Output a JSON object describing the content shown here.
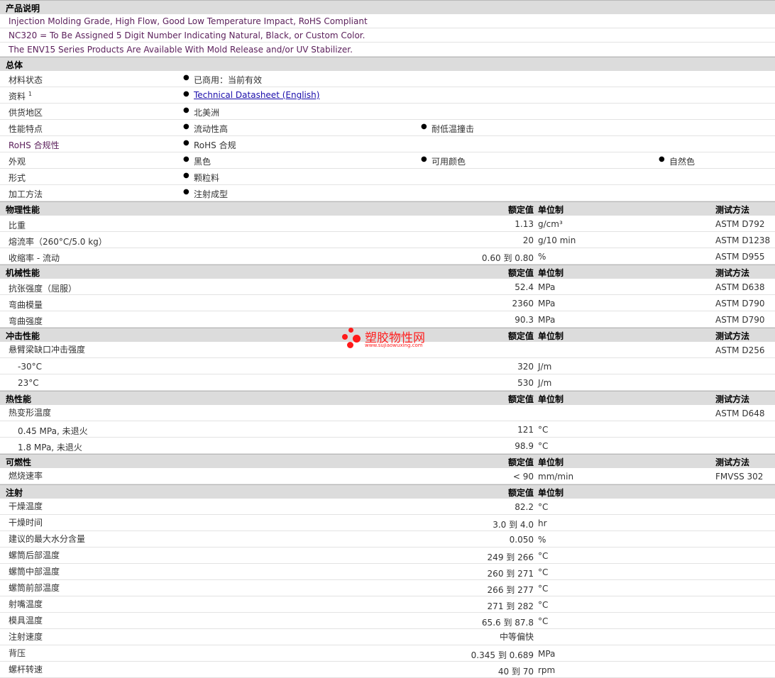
{
  "sections": {
    "product_desc": "产品说明",
    "general": "总体",
    "physical": "物理性能",
    "mechanical": "机械性能",
    "impact": "冲击性能",
    "thermal": "热性能",
    "flammability": "可燃性",
    "injection": "注射"
  },
  "headers": {
    "nominal": "额定值",
    "unit": "单位制",
    "method": "测试方法"
  },
  "bullet": "●",
  "description": [
    "Injection Molding Grade, High Flow, Good Low Temperature Impact, RoHS Compliant",
    "NC320 = To Be Assigned 5 Digit Number Indicating Natural, Black, or Custom Color.",
    "The ENV15 Series Products Are Available With Mold Release and/or UV Stabilizer."
  ],
  "general": {
    "material_status": {
      "label": "材料状态",
      "values": [
        "已商用：当前有效"
      ]
    },
    "documents": {
      "label": "资料",
      "sup": "1",
      "link": "Technical Datasheet (English)"
    },
    "availability": {
      "label": "供货地区",
      "values": [
        "北美洲"
      ]
    },
    "features": {
      "label": "性能特点",
      "values": [
        "流动性高",
        "耐低温撞击"
      ]
    },
    "rohs": {
      "label": "RoHS 合规性",
      "values": [
        "RoHS 合规"
      ]
    },
    "appearance": {
      "label": "外观",
      "values": [
        "黑色",
        "可用颜色",
        "自然色"
      ]
    },
    "forms": {
      "label": "形式",
      "values": [
        "颗粒料"
      ]
    },
    "processing": {
      "label": "加工方法",
      "values": [
        "注射成型"
      ]
    }
  },
  "physical": [
    {
      "label": "比重",
      "value": "1.13",
      "unit": "g/cm³",
      "method": "ASTM D792"
    },
    {
      "label": "熔流率（260°C/5.0 kg）",
      "value": "20",
      "unit": "g/10 min",
      "method": "ASTM D1238"
    },
    {
      "label": "收缩率 - 流动",
      "value": "0.60 到  0.80",
      "unit": "%",
      "method": "ASTM D955"
    }
  ],
  "mechanical": [
    {
      "label": "抗张强度（屈服）",
      "value": "52.4",
      "unit": "MPa",
      "method": "ASTM D638"
    },
    {
      "label": "弯曲模量",
      "value": "2360",
      "unit": "MPa",
      "method": "ASTM D790"
    },
    {
      "label": "弯曲强度",
      "value": "90.3",
      "unit": "MPa",
      "method": "ASTM D790"
    }
  ],
  "impact": {
    "label": "悬臂梁缺口冲击强度",
    "method": "ASTM D256",
    "rows": [
      {
        "label": "-30°C",
        "value": "320",
        "unit": "J/m"
      },
      {
        "label": "23°C",
        "value": "530",
        "unit": "J/m"
      }
    ]
  },
  "thermal": {
    "label": "热变形温度",
    "method": "ASTM D648",
    "rows": [
      {
        "label": "0.45 MPa, 未退火",
        "value": "121",
        "unit": "°C"
      },
      {
        "label": "1.8 MPa, 未退火",
        "value": "98.9",
        "unit": "°C"
      }
    ]
  },
  "flammability": [
    {
      "label": "燃烧速率",
      "value": "< 90",
      "unit": "mm/min",
      "method": "FMVSS 302"
    }
  ],
  "injection": [
    {
      "label": "干燥温度",
      "value": "82.2",
      "unit": "°C"
    },
    {
      "label": "干燥时间",
      "value": "3.0 到  4.0",
      "unit": "hr"
    },
    {
      "label": "建议的最大水分含量",
      "value": "0.050",
      "unit": "%"
    },
    {
      "label": "螺筒后部温度",
      "value": "249 到  266",
      "unit": "°C"
    },
    {
      "label": "螺筒中部温度",
      "value": "260 到  271",
      "unit": "°C"
    },
    {
      "label": "螺筒前部温度",
      "value": "266 到  277",
      "unit": "°C"
    },
    {
      "label": "射嘴温度",
      "value": "271 到  282",
      "unit": "°C"
    },
    {
      "label": "模具温度",
      "value": "65.6 到  87.8",
      "unit": "°C"
    },
    {
      "label": "注射速度",
      "value": "中等偏快",
      "unit": ""
    },
    {
      "label": "背压",
      "value": "0.345 到  0.689",
      "unit": "MPa"
    },
    {
      "label": "螺杆转速",
      "value": "40 到  70",
      "unit": "rpm"
    }
  ],
  "watermark": {
    "text": "塑胶物性网",
    "url": "www.sujiaowuxing.com"
  }
}
